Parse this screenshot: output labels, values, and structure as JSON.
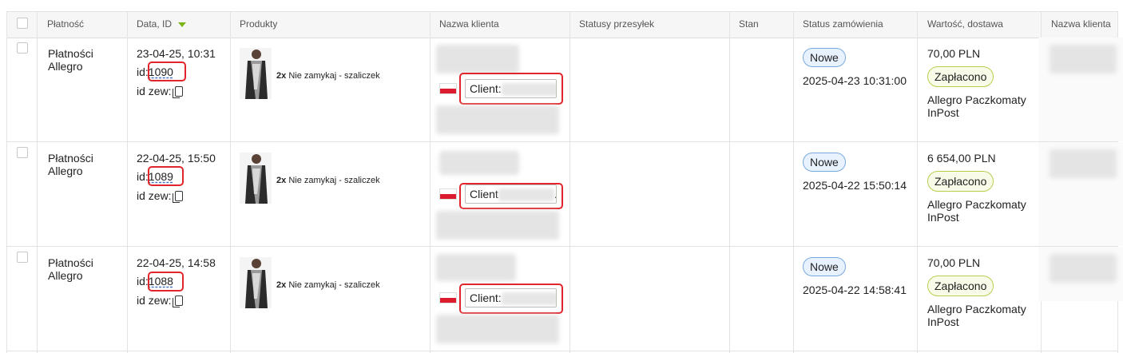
{
  "headers": {
    "payment": "Płatność",
    "date_id": "Data, ID",
    "products": "Produkty",
    "client_name": "Nazwa klienta",
    "shipment_statuses": "Statusy przesyłek",
    "state": "Stan",
    "order_status": "Status zamówienia",
    "value_delivery": "Wartość, dostawa",
    "client_name2": "Nazwa klienta"
  },
  "icons": {
    "sort": "sort-desc-icon",
    "copy": "copy-icon",
    "flag": "poland-flag-icon"
  },
  "colors": {
    "highlight": "#e0262a",
    "sort_arrow": "#7cb518",
    "badge_new_border": "#7aa9e0",
    "badge_paid_border": "#b7cf4f"
  },
  "rows": [
    {
      "payment": [
        "Płatności",
        "Allegro"
      ],
      "datetime": "23-04-25, 10:31",
      "id_label": "id:",
      "id": "1090",
      "ext_id_label": "id zew:",
      "product_qty": "2x",
      "product_name": "Nie zamykaj - szaliczek",
      "client_field": "Client:",
      "client_ellipsis": "...",
      "status_badge": "Nowe",
      "status_time": "2025-04-23 10:31:00",
      "value": "70,00 PLN",
      "paid_badge": "Zapłacono",
      "delivery": [
        "Allegro Paczkomaty",
        "InPost"
      ]
    },
    {
      "payment": [
        "Płatności",
        "Allegro"
      ],
      "datetime": "22-04-25, 15:50",
      "id_label": "id:",
      "id": "1089",
      "ext_id_label": "id zew:",
      "product_qty": "2x",
      "product_name": "Nie zamykaj - szaliczek",
      "client_field": "Client",
      "client_ellipsis": "...",
      "status_badge": "Nowe",
      "status_time": "2025-04-22 15:50:14",
      "value": "6 654,00 PLN",
      "paid_badge": "Zapłacono",
      "delivery": [
        "Allegro Paczkomaty",
        "InPost"
      ]
    },
    {
      "payment": [
        "Płatności",
        "Allegro"
      ],
      "datetime": "22-04-25, 14:58",
      "id_label": "id:",
      "id": "1088",
      "ext_id_label": "id zew:",
      "product_qty": "2x",
      "product_name": "Nie zamykaj - szaliczek",
      "client_field": "Client:",
      "client_ellipsis": "...",
      "status_badge": "Nowe",
      "status_time": "2025-04-22 14:58:41",
      "value": "70,00 PLN",
      "paid_badge": "Zapłacono",
      "delivery": [
        "Allegro Paczkomaty",
        "InPost"
      ]
    }
  ]
}
